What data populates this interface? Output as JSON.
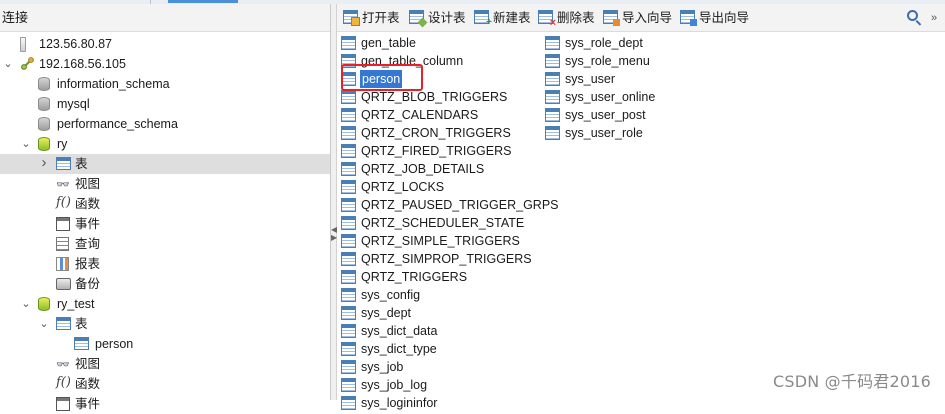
{
  "left_panel": {
    "header": "连接",
    "tree": [
      {
        "label": "123.56.80.87",
        "icon": "server-icon",
        "depth": 0,
        "expanded": null
      },
      {
        "label": "192.168.56.105",
        "icon": "connection-icon",
        "depth": 0,
        "expanded": true
      },
      {
        "label": "information_schema",
        "icon": "database-icon",
        "depth": 1,
        "expanded": null
      },
      {
        "label": "mysql",
        "icon": "database-icon",
        "depth": 1,
        "expanded": null
      },
      {
        "label": "performance_schema",
        "icon": "database-icon",
        "depth": 1,
        "expanded": null
      },
      {
        "label": "ry",
        "icon": "database-open-icon",
        "depth": 1,
        "expanded": true
      },
      {
        "label": "表",
        "icon": "table-icon",
        "depth": 2,
        "expanded": false,
        "selected": true
      },
      {
        "label": "视图",
        "icon": "view-icon",
        "depth": 2,
        "expanded": null
      },
      {
        "label": "函数",
        "icon": "function-icon",
        "depth": 2,
        "expanded": null
      },
      {
        "label": "事件",
        "icon": "event-icon",
        "depth": 2,
        "expanded": null
      },
      {
        "label": "查询",
        "icon": "query-icon",
        "depth": 2,
        "expanded": null
      },
      {
        "label": "报表",
        "icon": "report-icon",
        "depth": 2,
        "expanded": null
      },
      {
        "label": "备份",
        "icon": "backup-icon",
        "depth": 2,
        "expanded": null
      },
      {
        "label": "ry_test",
        "icon": "database-open-icon",
        "depth": 1,
        "expanded": true
      },
      {
        "label": "表",
        "icon": "table-icon",
        "depth": 2,
        "expanded": true
      },
      {
        "label": "person",
        "icon": "table-icon",
        "depth": 3,
        "expanded": null
      },
      {
        "label": "视图",
        "icon": "view-icon",
        "depth": 2,
        "expanded": null
      },
      {
        "label": "函数",
        "icon": "function-icon",
        "depth": 2,
        "expanded": null
      },
      {
        "label": "事件",
        "icon": "event-icon",
        "depth": 2,
        "expanded": null
      }
    ]
  },
  "toolbar": {
    "open_table": "打开表",
    "design_table": "设计表",
    "new_table": "新建表",
    "delete_table": "删除表",
    "import_wizard": "导入向导",
    "export_wizard": "导出向导"
  },
  "tables": {
    "column1": [
      "gen_table",
      "gen_table_column",
      "person",
      "QRTZ_BLOB_TRIGGERS",
      "QRTZ_CALENDARS",
      "QRTZ_CRON_TRIGGERS",
      "QRTZ_FIRED_TRIGGERS",
      "QRTZ_JOB_DETAILS",
      "QRTZ_LOCKS",
      "QRTZ_PAUSED_TRIGGER_GRPS",
      "QRTZ_SCHEDULER_STATE",
      "QRTZ_SIMPLE_TRIGGERS",
      "QRTZ_SIMPROP_TRIGGERS",
      "QRTZ_TRIGGERS",
      "sys_config",
      "sys_dept",
      "sys_dict_data",
      "sys_dict_type",
      "sys_job",
      "sys_job_log",
      "sys_logininfor"
    ],
    "column2": [
      "sys_role_dept",
      "sys_role_menu",
      "sys_user",
      "sys_user_online",
      "sys_user_post",
      "sys_user_role"
    ],
    "selected": "person"
  },
  "watermark": "CSDN @千码君2016",
  "colors": {
    "selection": "#3478d4",
    "highlight_box": "#e6212a",
    "tree_selected": "#dedede"
  }
}
